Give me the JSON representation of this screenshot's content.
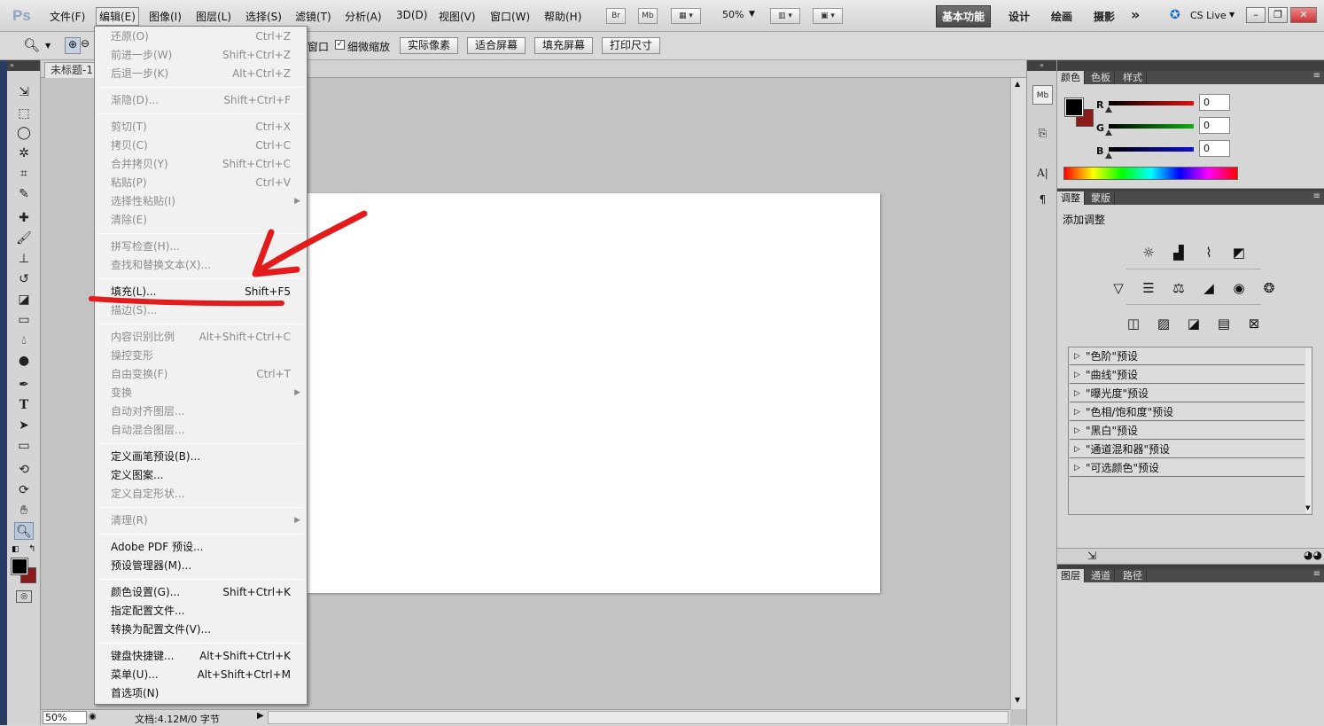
{
  "menubar": {
    "logo": "Ps",
    "items": [
      "文件(F)",
      "编辑(E)",
      "图像(I)",
      "图层(L)",
      "选择(S)",
      "滤镜(T)",
      "分析(A)",
      "3D(D)",
      "视图(V)",
      "窗口(W)",
      "帮助(H)"
    ],
    "bridge": "Br",
    "minibridge": "Mb",
    "zoom": "50%",
    "workspaces": [
      "基本功能",
      "设计",
      "绘画",
      "摄影"
    ],
    "more": "»",
    "cslive": "CS Live"
  },
  "options": {
    "window_label": "窗口",
    "scrubby_zoom": "细微缩放",
    "buttons": [
      "实际像素",
      "适合屏幕",
      "填充屏幕",
      "打印尺寸"
    ]
  },
  "document": {
    "tab_title": "未标题-1",
    "zoom": "50%",
    "status": "文档:4.12M/0 字节"
  },
  "edit_menu": [
    {
      "label": "还原(O)",
      "shortcut": "Ctrl+Z",
      "disabled": true
    },
    {
      "label": "前进一步(W)",
      "shortcut": "Shift+Ctrl+Z",
      "disabled": true
    },
    {
      "label": "后退一步(K)",
      "shortcut": "Alt+Ctrl+Z",
      "disabled": true
    },
    {
      "sep": true
    },
    {
      "label": "渐隐(D)...",
      "shortcut": "Shift+Ctrl+F",
      "disabled": true
    },
    {
      "sep": true
    },
    {
      "label": "剪切(T)",
      "shortcut": "Ctrl+X",
      "disabled": true
    },
    {
      "label": "拷贝(C)",
      "shortcut": "Ctrl+C",
      "disabled": true
    },
    {
      "label": "合并拷贝(Y)",
      "shortcut": "Shift+Ctrl+C",
      "disabled": true
    },
    {
      "label": "粘贴(P)",
      "shortcut": "Ctrl+V",
      "disabled": true
    },
    {
      "label": "选择性粘贴(I)",
      "shortcut": "",
      "disabled": true,
      "submenu": true
    },
    {
      "label": "清除(E)",
      "shortcut": "",
      "disabled": true
    },
    {
      "sep": true
    },
    {
      "label": "拼写检查(H)...",
      "shortcut": "",
      "disabled": true
    },
    {
      "label": "查找和替换文本(X)...",
      "shortcut": "",
      "disabled": true
    },
    {
      "sep": true
    },
    {
      "label": "填充(L)...",
      "shortcut": "Shift+F5",
      "disabled": false
    },
    {
      "label": "描边(S)...",
      "shortcut": "",
      "disabled": true
    },
    {
      "sep": true
    },
    {
      "label": "内容识别比例",
      "shortcut": "Alt+Shift+Ctrl+C",
      "disabled": true
    },
    {
      "label": "操控变形",
      "shortcut": "",
      "disabled": true
    },
    {
      "label": "自由变换(F)",
      "shortcut": "Ctrl+T",
      "disabled": true
    },
    {
      "label": "变换",
      "shortcut": "",
      "disabled": true,
      "submenu": true
    },
    {
      "label": "自动对齐图层...",
      "shortcut": "",
      "disabled": true
    },
    {
      "label": "自动混合图层...",
      "shortcut": "",
      "disabled": true
    },
    {
      "sep": true
    },
    {
      "label": "定义画笔预设(B)...",
      "shortcut": "",
      "disabled": false
    },
    {
      "label": "定义图案...",
      "shortcut": "",
      "disabled": false
    },
    {
      "label": "定义自定形状...",
      "shortcut": "",
      "disabled": true
    },
    {
      "sep": true
    },
    {
      "label": "清理(R)",
      "shortcut": "",
      "disabled": true,
      "submenu": true
    },
    {
      "sep": true
    },
    {
      "label": "Adobe PDF 预设...",
      "shortcut": "",
      "disabled": false
    },
    {
      "label": "预设管理器(M)...",
      "shortcut": "",
      "disabled": false
    },
    {
      "sep": true
    },
    {
      "label": "颜色设置(G)...",
      "shortcut": "Shift+Ctrl+K",
      "disabled": false
    },
    {
      "label": "指定配置文件...",
      "shortcut": "",
      "disabled": false
    },
    {
      "label": "转换为配置文件(V)...",
      "shortcut": "",
      "disabled": false
    },
    {
      "sep": true
    },
    {
      "label": "键盘快捷键...",
      "shortcut": "Alt+Shift+Ctrl+K",
      "disabled": false
    },
    {
      "label": "菜单(U)...",
      "shortcut": "Alt+Shift+Ctrl+M",
      "disabled": false
    },
    {
      "label": "首选项(N)",
      "shortcut": "",
      "disabled": false
    }
  ],
  "color_panel": {
    "tabs": [
      "颜色",
      "色板",
      "样式"
    ],
    "channels": [
      {
        "name": "R",
        "value": "0",
        "color": "#e01010"
      },
      {
        "name": "G",
        "value": "0",
        "color": "#10b010"
      },
      {
        "name": "B",
        "value": "0",
        "color": "#1010d0"
      }
    ],
    "foreground": "#000000",
    "background": "#8b1a1a"
  },
  "adjust_panel": {
    "tabs": [
      "调整",
      "蒙版"
    ],
    "title": "添加调整",
    "presets": [
      "\"色阶\"预设",
      "\"曲线\"预设",
      "\"曝光度\"预设",
      "\"色相/饱和度\"预设",
      "\"黑白\"预设",
      "\"通道混和器\"预设",
      "\"可选颜色\"预设"
    ]
  },
  "layers_panel": {
    "tabs": [
      "图层",
      "通道",
      "路径"
    ]
  },
  "annotation_color": "#e31b1b"
}
